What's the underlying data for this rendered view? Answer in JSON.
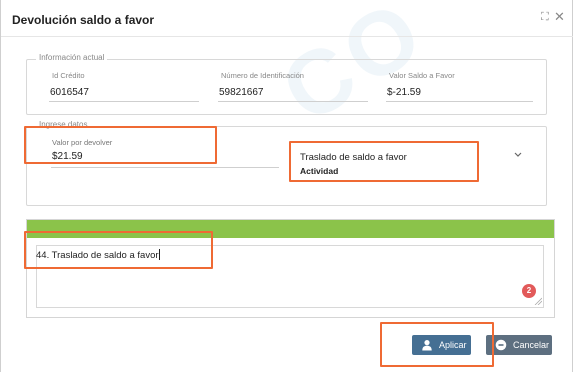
{
  "dialog": {
    "title": "Devolución saldo a favor",
    "watermark": "CO"
  },
  "info": {
    "legend": "Información actual",
    "fields": [
      {
        "label": "Id Crédito",
        "value": "6016547"
      },
      {
        "label": "Número de Identificación",
        "value": "59821667"
      },
      {
        "label": "Valor Saldo a Favor",
        "value": "$-21.59"
      }
    ]
  },
  "ingrese": {
    "legend": "Ingrese datos",
    "valor_label": "Valor por devolver",
    "valor_value": "$21.59",
    "actividad_value": "Traslado de saldo a favor",
    "actividad_caption": "Actividad"
  },
  "observacion": {
    "text": "44. Traslado de saldo a favor",
    "error_count": "2"
  },
  "buttons": {
    "aplicar": "Aplicar",
    "cancelar": "Cancelar"
  },
  "icons": {
    "maximize": "maximize-icon",
    "close": "close-icon",
    "select_chevron": "chevron-down-icon",
    "aplicar": "user-icon",
    "cancelar": "cancel-circle-icon"
  },
  "colors": {
    "observacion_header": "#8bc34a",
    "aplicar_button": "#456f93",
    "cancelar_button": "#5d6f80",
    "highlight": "#ef6a34",
    "error_badge": "#e25a5a"
  }
}
